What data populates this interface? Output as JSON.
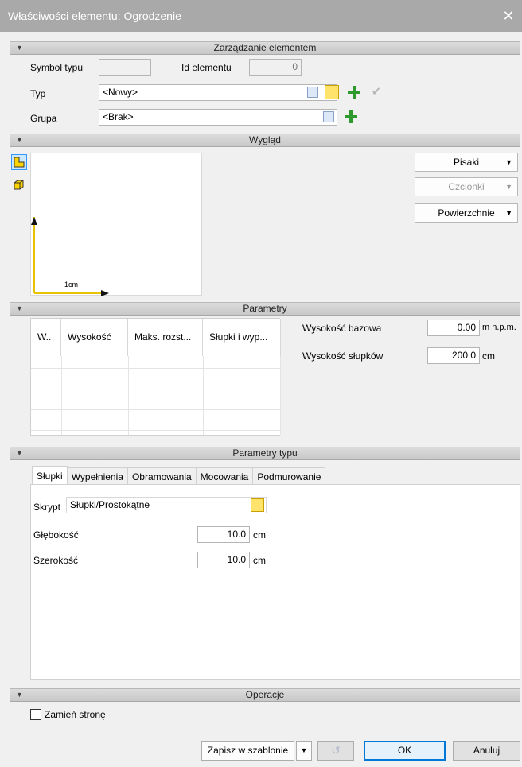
{
  "window": {
    "title": "Właściwości elementu: Ogrodzenie"
  },
  "sections": {
    "management": "Zarządzanie elementem",
    "appearance": "Wygląd",
    "parameters": "Parametry",
    "type_parameters": "Parametry typu",
    "operations": "Operacje"
  },
  "management": {
    "symbol_label": "Symbol typu",
    "symbol_value": "",
    "id_label": "Id elementu",
    "id_value": "0",
    "type_label": "Typ",
    "type_value": "<Nowy>",
    "group_label": "Grupa",
    "group_value": "<Brak>"
  },
  "appearance": {
    "scale_label": "1cm",
    "buttons": [
      "Pisaki",
      "Czcionki",
      "Powierzchnie"
    ]
  },
  "parameters": {
    "columns": [
      "W..",
      "Wysokość",
      "Maks. rozst...",
      "Słupki i wyp..."
    ],
    "base_height_label": "Wysokość bazowa",
    "base_height_value": "0.00",
    "base_height_unit": "m n.p.m.",
    "post_height_label": "Wysokość słupków",
    "post_height_value": "200.0",
    "post_height_unit": "cm"
  },
  "type_parameters": {
    "tabs": [
      "Słupki",
      "Wypełnienia",
      "Obramowania",
      "Mocowania",
      "Podmurowanie"
    ],
    "script_label": "Skrypt",
    "script_value": "Słupki/Prostokątne",
    "depth_label": "Głębokość",
    "depth_value": "10.0",
    "depth_unit": "cm",
    "width_label": "Szerokość",
    "width_value": "10.0",
    "width_unit": "cm"
  },
  "operations": {
    "swap_label": "Zamień stronę"
  },
  "footer": {
    "save_template": "Zapisz w szablonie",
    "ok": "OK",
    "cancel": "Anuluj"
  },
  "colors": {
    "titlebar": "#a9a9a9",
    "accent": "#0078d7",
    "plus": "#2e9a2e",
    "axis": "#e6c200"
  }
}
